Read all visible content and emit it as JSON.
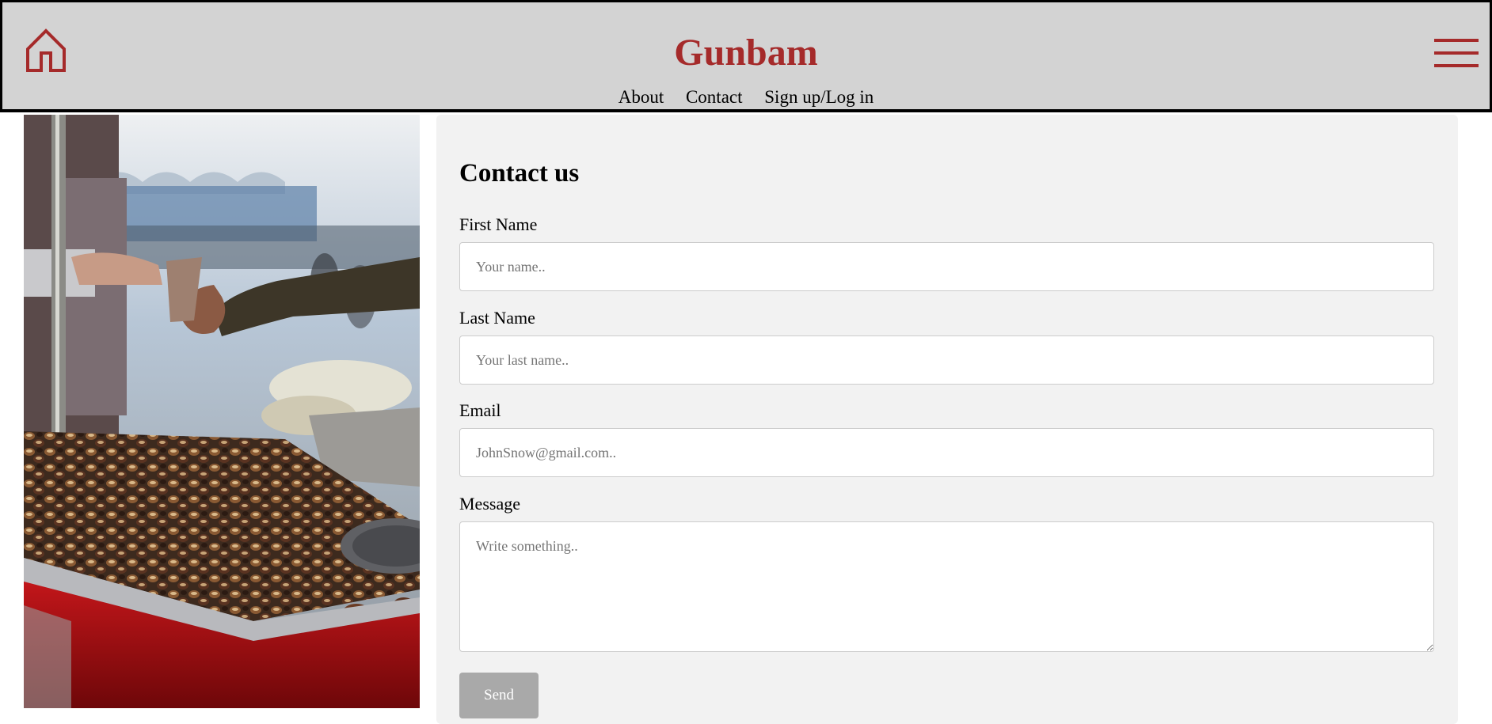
{
  "header": {
    "brand": "Gunbam",
    "home_icon": "home-icon",
    "menu_icon": "hamburger-menu-icon",
    "nav": [
      {
        "label": "About"
      },
      {
        "label": "Contact"
      },
      {
        "label": "Sign up/Log in"
      }
    ]
  },
  "hero_image": {
    "subject": "roasted chestnuts street vendor"
  },
  "contact": {
    "title": "Contact us",
    "first_name": {
      "label": "First Name",
      "placeholder": "Your name.."
    },
    "last_name": {
      "label": "Last Name",
      "placeholder": "Your last name.."
    },
    "email": {
      "label": "Email",
      "placeholder": "JohnSnow@gmail.com.."
    },
    "message": {
      "label": "Message",
      "placeholder": "Write something.."
    },
    "send_label": "Send"
  },
  "colors": {
    "brand": "#a52a2a",
    "header_bg": "#d3d3d3",
    "card_bg": "#f2f2f2",
    "button_bg": "#a9a9a9"
  }
}
